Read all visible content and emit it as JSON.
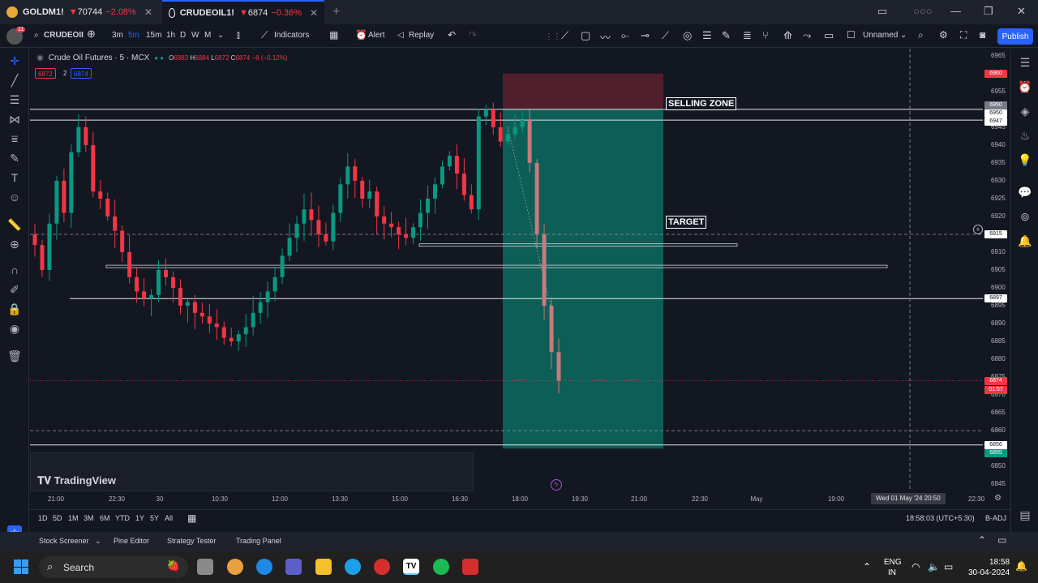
{
  "tabs": [
    {
      "symbol": "GOLDM1!",
      "arrow": "▼",
      "price": "70744",
      "change": "−2.08%",
      "close": "✕"
    },
    {
      "symbol": "CRUDEOIL1!",
      "arrow": "▼",
      "price": "6874",
      "change": "−0.36%",
      "close": "✕"
    }
  ],
  "toolbar": {
    "symbol": "CRUDEOII",
    "intervals": [
      "3m",
      "5m",
      "15m",
      "1h",
      "D",
      "W",
      "M"
    ],
    "indicators": "Indicators",
    "alert": "Alert",
    "replay": "Replay",
    "layout_name": "Unnamed",
    "publish": "Publish",
    "notif_count": "11"
  },
  "legend": {
    "title": "Crude Oil Futures · 5 · MCX",
    "o_label": "O",
    "o": "6883",
    "h_label": "H",
    "h": "6884",
    "l_label": "L",
    "l": "6872",
    "c_label": "C",
    "c": "6874",
    "chg": "−8 (−0.12%)",
    "bid": "6872",
    "spread": "2",
    "ask": "6874"
  },
  "annotations": {
    "selling_zone": "SELLING ZONE",
    "target": "TARGET"
  },
  "watermark": "TradingView",
  "price_axis": {
    "ticks": [
      "6965",
      "6960",
      "6955",
      "6950",
      "6945",
      "6940",
      "6935",
      "6930",
      "6925",
      "6920",
      "6915",
      "6910",
      "6905",
      "6900",
      "6895",
      "6890",
      "6885",
      "6880",
      "6875",
      "6870",
      "6865",
      "6860",
      "6855",
      "6850",
      "6845"
    ],
    "labels": [
      {
        "text": "6960",
        "price": 6960,
        "bg": "#f23645",
        "fg": "#ffffff"
      },
      {
        "text": "6950",
        "price": 6951.2,
        "bg": "#787b86",
        "fg": "#ffffff"
      },
      {
        "text": "6950",
        "price": 6948.9,
        "bg": "#ffffff",
        "fg": "#131722"
      },
      {
        "text": "6947",
        "price": 6946.6,
        "bg": "#ffffff",
        "fg": "#131722"
      },
      {
        "text": "6915",
        "price": 6915,
        "bg": "#ffffff",
        "fg": "#131722"
      },
      {
        "text": "6897",
        "price": 6897,
        "bg": "#ffffff",
        "fg": "#131722"
      },
      {
        "text": "6874",
        "price": 6874,
        "bg": "#f23645",
        "fg": "#ffffff"
      },
      {
        "text": "01:57",
        "price": 6871.5,
        "bg": "#f23645",
        "fg": "#ffffff"
      },
      {
        "text": "6856",
        "price": 6855.9,
        "bg": "#ffffff",
        "fg": "#131722"
      },
      {
        "text": "6855",
        "price": 6853.6,
        "bg": "#089981",
        "fg": "#ffffff"
      }
    ]
  },
  "time_axis": {
    "ticks": [
      "21:00",
      "22:30",
      "30",
      "10:30",
      "12:00",
      "13:30",
      "15:00",
      "16:30",
      "18:00",
      "19:30",
      "21:00",
      "22:30",
      "May",
      "19:00"
    ],
    "cursor_label": "Wed 01 May '24   20:50",
    "last": "22:30"
  },
  "range_bar": {
    "ranges": [
      "1D",
      "5D",
      "1M",
      "3M",
      "6M",
      "YTD",
      "1Y",
      "5Y",
      "All"
    ],
    "clock": "18:58:03 (UTC+5:30)",
    "adj": "B-ADJ"
  },
  "bottom_panel": [
    "Stock Screener",
    "Pine Editor",
    "Strategy Tester",
    "Trading Panel"
  ],
  "taskbar": {
    "search": "Search",
    "lang": "ENG",
    "region": "IN",
    "time": "18:58",
    "date": "30-04-2024"
  },
  "colors": {
    "up": "#089981",
    "down": "#f23645",
    "bg": "#131722",
    "accent": "#2962ff",
    "stop_zone": "rgba(242,54,69,0.28)",
    "profit_zone": "rgba(8,153,129,0.55)"
  },
  "chart_data": {
    "type": "candlestick",
    "title": "Crude Oil Futures · 5 · MCX",
    "ylim": [
      6843,
      6967
    ],
    "close_series": [
      6912,
      6905,
      6918,
      6930,
      6921,
      6938,
      6945,
      6940,
      6927,
      6925,
      6920,
      6916,
      6910,
      6903,
      6899,
      6897,
      6898,
      6905,
      6903,
      6900,
      6895,
      6896,
      6893,
      6892,
      6890,
      6889,
      6886,
      6885,
      6887,
      6889,
      6893,
      6896,
      6899,
      6903,
      6909,
      6914,
      6918,
      6922,
      6919,
      6915,
      6913,
      6921,
      6929,
      6934,
      6930,
      6925,
      6927,
      6920,
      6918,
      6917,
      6915,
      6914,
      6917,
      6921,
      6925,
      6929,
      6934,
      6937,
      6932,
      6926,
      6922,
      6948,
      6950,
      6945,
      6941,
      6943,
      6945,
      6947,
      6935,
      6915,
      6895,
      6882,
      6874
    ],
    "horizontal_levels": [
      6950,
      6947,
      6915,
      6912,
      6906,
      6897,
      6860,
      6856
    ],
    "position": {
      "entry": 6950,
      "stop": 6960,
      "target": 6855
    }
  }
}
